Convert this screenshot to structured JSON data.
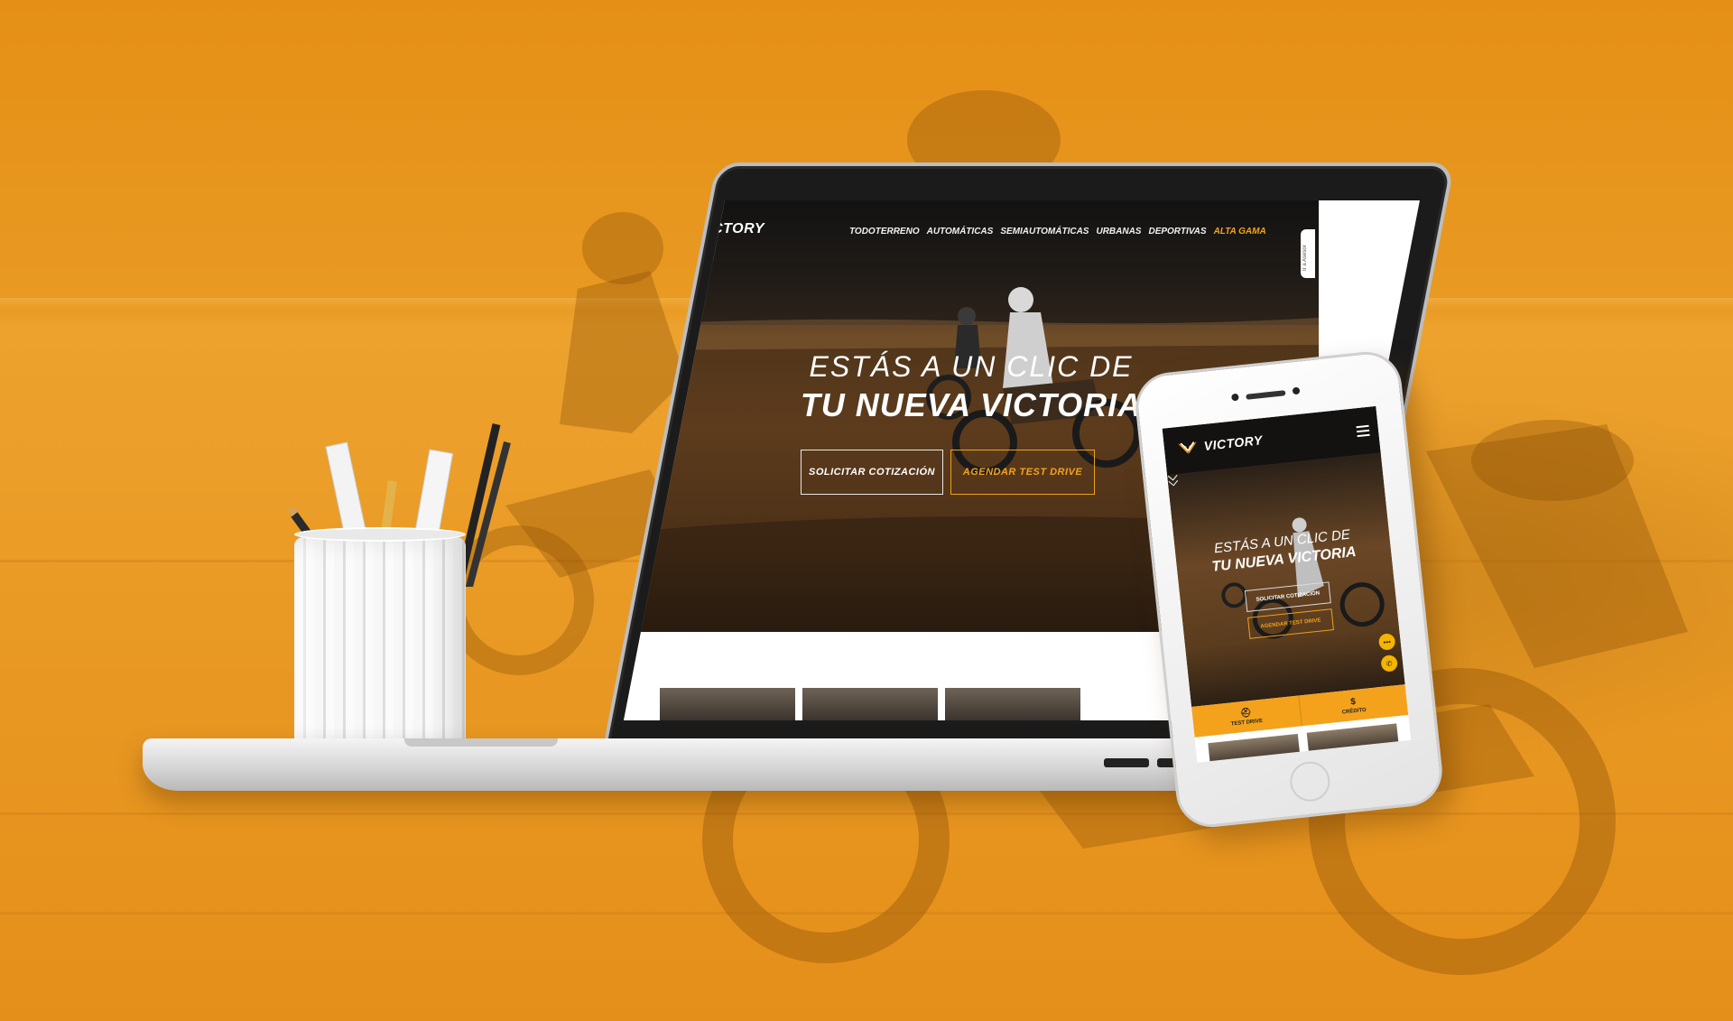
{
  "colors": {
    "background": "#e8951c",
    "accent_gold": "#f4a21c",
    "nav_dark": "#141210",
    "whatsapp_bubble": "#f4b400"
  },
  "desktop_site": {
    "logo_text": "VICTORY",
    "logo_icon": "winged-v-logo",
    "nav": [
      "TODOTERRENO",
      "AUTOMÁTICAS",
      "SEMIAUTOMÁTICAS",
      "URBANAS",
      "DEPORTIVAS",
      "ALTA GAMA"
    ],
    "nav_accent_index": 5,
    "side_tab_label": "Ir a Asesor",
    "hero": {
      "line1": "ESTÁS A UN CLIC DE",
      "line2": "TU NUEVA VICTORIA"
    },
    "buttons": {
      "primary": "SOLICITAR COTIZACIÓN",
      "secondary": "AGENDAR TEST DRIVE"
    },
    "scroll_icon": "chevron-down-icon",
    "whatsapp_icon": "whatsapp-icon"
  },
  "mobile_site": {
    "logo_text": "VICTORY",
    "menu_icon": "hamburger-menu-icon",
    "hero": {
      "line1": "ESTÁS A UN CLIC DE",
      "line2": "TU NUEVA VICTORIA"
    },
    "buttons": {
      "primary": "SOLICITAR COTIZACIÓN",
      "secondary": "AGENDAR TEST DRIVE"
    },
    "tabs": [
      {
        "label": "TEST DRIVE",
        "icon": "helmet-icon"
      },
      {
        "label": "CRÉDITO",
        "icon": "money-icon"
      }
    ]
  }
}
